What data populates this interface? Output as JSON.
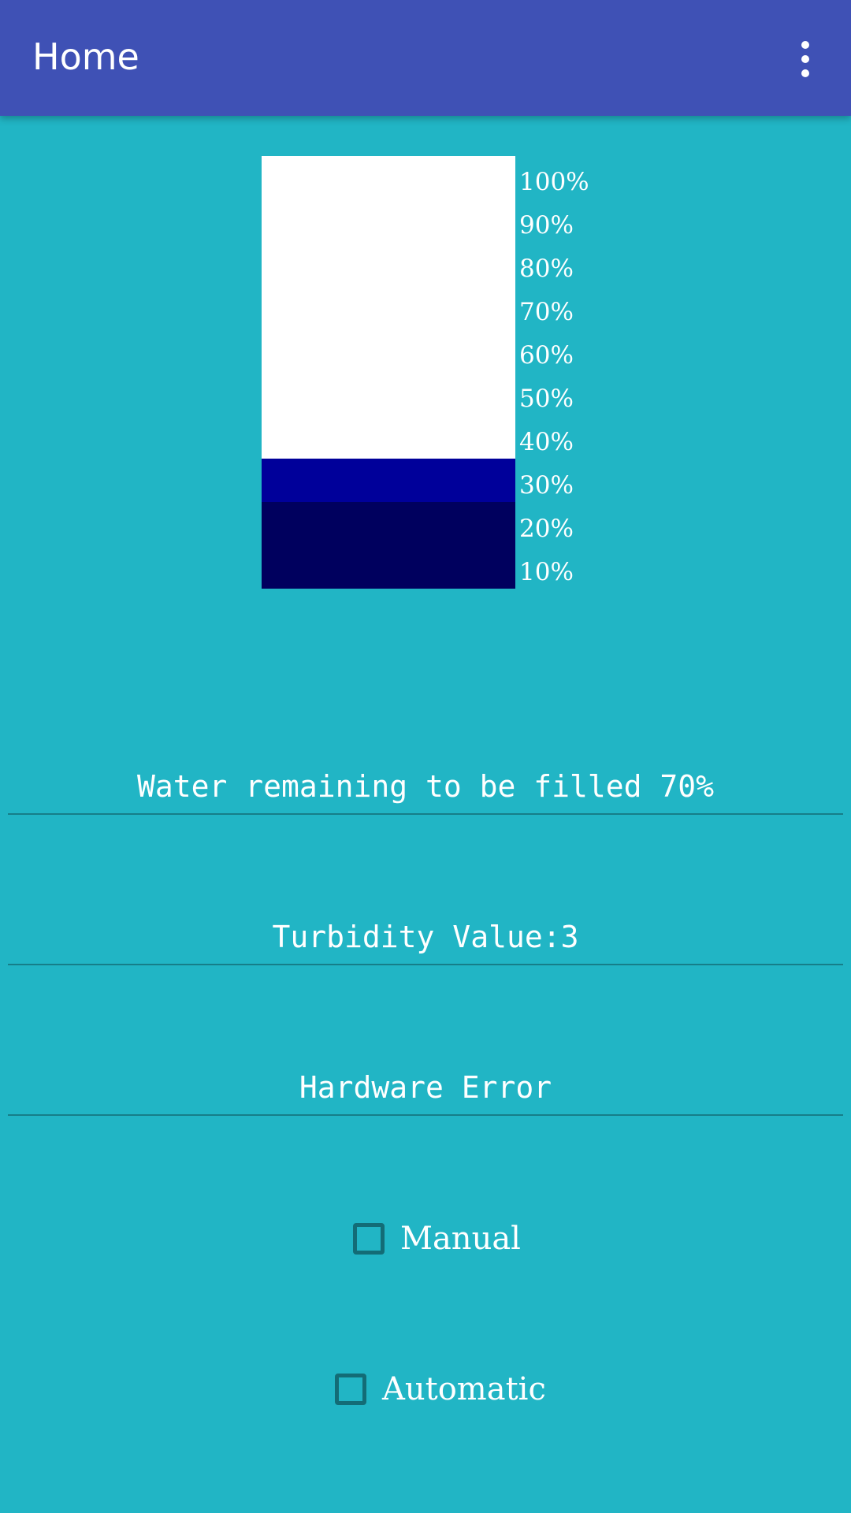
{
  "app_bar": {
    "title": "Home",
    "menu_icon": "more-vert-icon",
    "color": "#3F51B5"
  },
  "background_color": "#21B5C5",
  "tank": {
    "scale_labels": [
      "100%",
      "90%",
      "80%",
      "70%",
      "60%",
      "50%",
      "40%",
      "30%",
      "20%",
      "10%"
    ],
    "filled_fraction": 0.3,
    "colors": {
      "empty": "#FFFFFF",
      "level_low": "#00005E",
      "level_mid": "#00009A"
    }
  },
  "water_remaining": {
    "text": "Water remaining to be filled 70%"
  },
  "turbidity": {
    "text": "Turbidity Value:3"
  },
  "hardware_status": {
    "text": "Hardware Error"
  },
  "mode": {
    "manual": {
      "label": "Manual",
      "checked": false
    },
    "automatic": {
      "label": "Automatic",
      "checked": false
    }
  }
}
